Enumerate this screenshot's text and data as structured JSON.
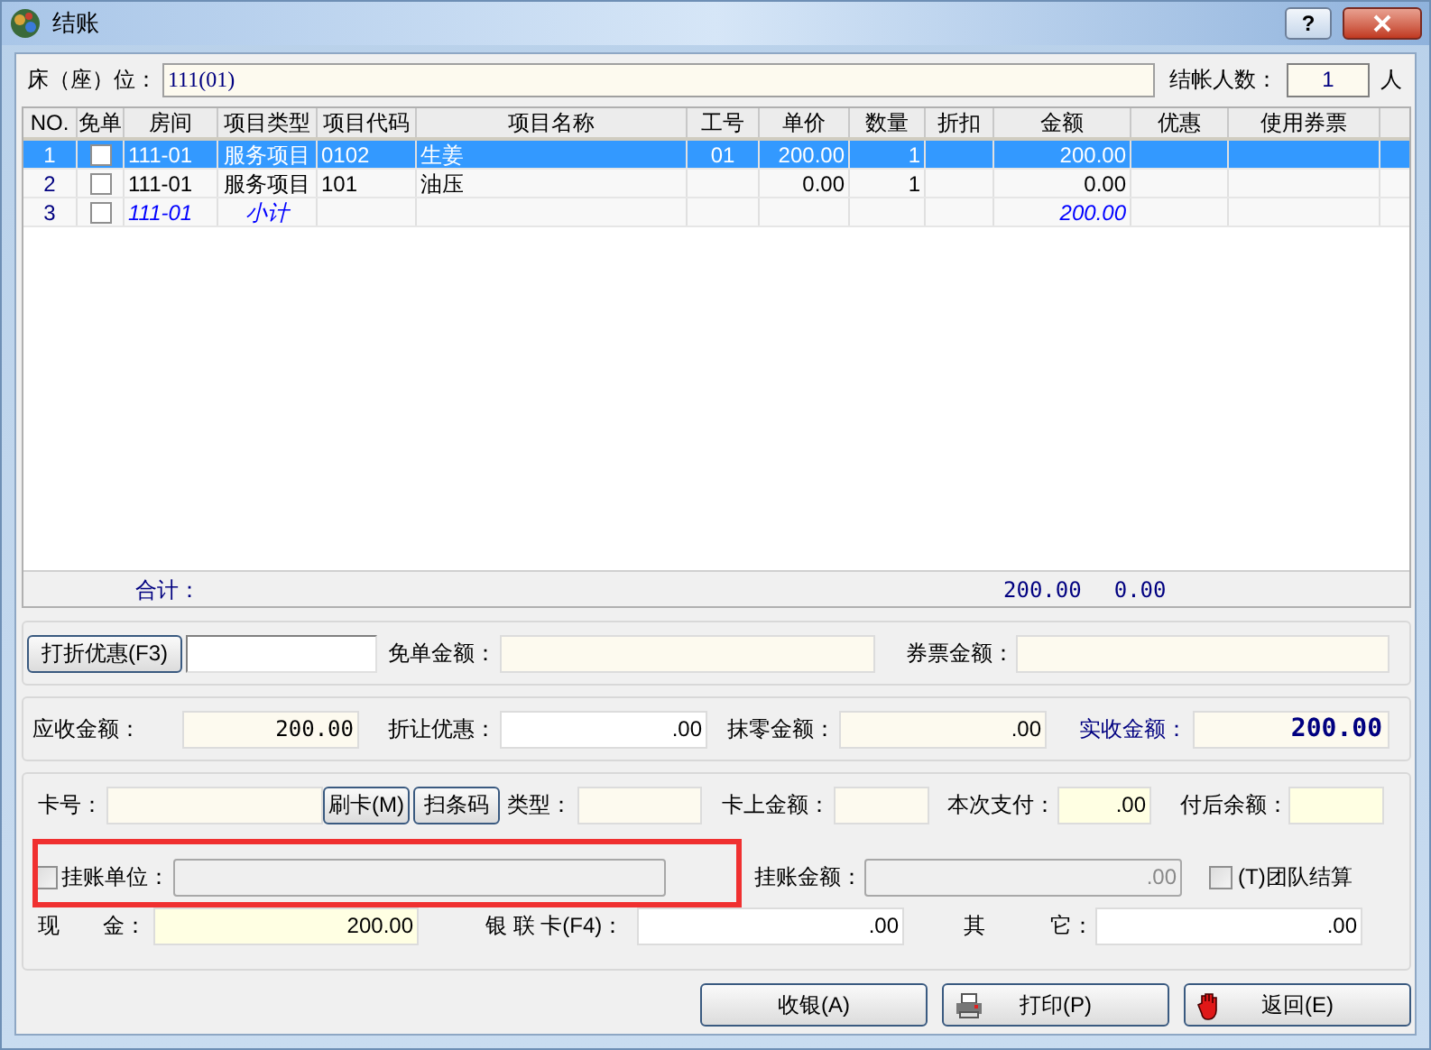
{
  "window": {
    "title": "结账",
    "help": "?"
  },
  "bed": {
    "label": "床（座）位：",
    "value": "111(01)"
  },
  "guests": {
    "label": "结帐人数：",
    "value": "1",
    "unit": "人"
  },
  "table": {
    "columns": [
      "NO.",
      "免单",
      "房间",
      "项目类型",
      "项目代码",
      "项目名称",
      "工号",
      "单价",
      "数量",
      "折扣",
      "金额",
      "优惠",
      "使用券票"
    ],
    "rows": [
      {
        "kind": "item",
        "selected": true,
        "free": false,
        "cells": {
          "no": "1",
          "room": "111-01",
          "type": "服务项目",
          "code": "0102",
          "name": "生姜",
          "staff": "01",
          "price": "200.00",
          "qty": "1",
          "amount": "200.00"
        }
      },
      {
        "kind": "item",
        "selected": false,
        "free": false,
        "cells": {
          "no": "2",
          "room": "111-01",
          "type": "服务项目",
          "code": "101",
          "name": "油压",
          "price": "0.00",
          "qty": "1",
          "amount": "0.00"
        }
      },
      {
        "kind": "subtotal",
        "selected": false,
        "free": false,
        "cells": {
          "no": "3",
          "room": "111-01",
          "type": "小计",
          "amount": "200.00"
        }
      }
    ]
  },
  "totals": {
    "label": "合计：",
    "amount": "200.00",
    "benefit": "0.00"
  },
  "discount": {
    "button": "打折优惠(F3)",
    "free_label": "免单金额：",
    "voucher_label": "券票金额："
  },
  "amounts": {
    "receivable": {
      "label": "应收金额：",
      "value": "200.00"
    },
    "allowance": {
      "label": "折让优惠：",
      "value": ".00"
    },
    "rounding": {
      "label": "抹零金额：",
      "value": ".00"
    },
    "received": {
      "label": "实收金额：",
      "value": "200.00"
    }
  },
  "card": {
    "number_label": "卡号：",
    "swipe_button": "刷卡(M)",
    "scan_button": "扫条码",
    "type_label": "类型：",
    "balance_label": "卡上金额：",
    "pay": {
      "label": "本次支付：",
      "value": ".00"
    },
    "after_label": "付后余额："
  },
  "credit": {
    "checked": false,
    "label": "挂账单位：",
    "amount": {
      "label": "挂账金额：",
      "value": ".00"
    },
    "team": {
      "checked": false,
      "label": "(T)团队结算"
    }
  },
  "payments": [
    {
      "label": "现　　金：",
      "value": "200.00"
    },
    {
      "label": "银 联 卡(F4)：",
      "value": ".00"
    },
    {
      "label": "其　　　它：",
      "value": ".00"
    }
  ],
  "buttons": [
    {
      "kind": "plain",
      "label": "收银(A)"
    },
    {
      "kind": "print",
      "label": "打印(P)"
    },
    {
      "kind": "return",
      "label": "返回(E)"
    }
  ]
}
